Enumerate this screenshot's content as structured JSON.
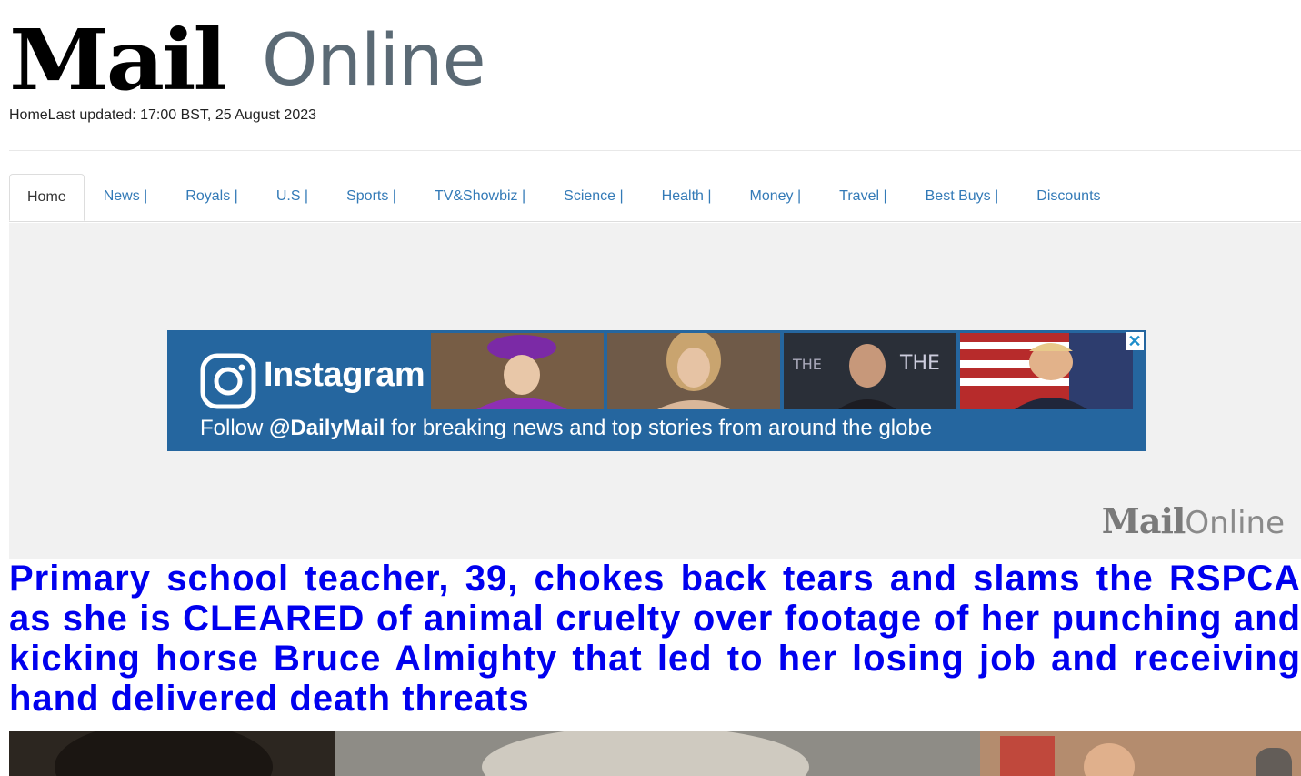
{
  "brand": {
    "logo_main": "Mail",
    "logo_sub": "Online"
  },
  "updated_text": "HomeLast updated: 17:00 BST, 25 August 2023",
  "nav": {
    "items": [
      {
        "label": "Home"
      },
      {
        "label": "News |"
      },
      {
        "label": "Royals |"
      },
      {
        "label": "U.S |"
      },
      {
        "label": "Sports |"
      },
      {
        "label": "TV&Showbiz |"
      },
      {
        "label": "Science |"
      },
      {
        "label": "Health |"
      },
      {
        "label": "Money |"
      },
      {
        "label": "Travel |"
      },
      {
        "label": "Best Buys |"
      },
      {
        "label": "Discounts"
      }
    ],
    "active_index": 0
  },
  "ad": {
    "brand": "Instagram",
    "follow_prefix": "Follow ",
    "follow_handle": "@DailyMail",
    "follow_suffix": " for breaking news and top stories from around the globe",
    "close_glyph": "✕",
    "watermark_main": "Mail",
    "watermark_sub": "Online",
    "colors": {
      "banner": "#25669f",
      "close": "#1e8ecb"
    }
  },
  "article": {
    "headline": "Primary school teacher, 39, chokes back tears and slams the RSPCA as she is CLEARED of animal cruelty over footage of her punching and kicking horse Bruce Almighty that led to her losing job and receiving hand delivered death threats"
  },
  "colors": {
    "link": "#337ab7",
    "headline": "#0000ee",
    "ad_bg": "#f1f1f1"
  }
}
